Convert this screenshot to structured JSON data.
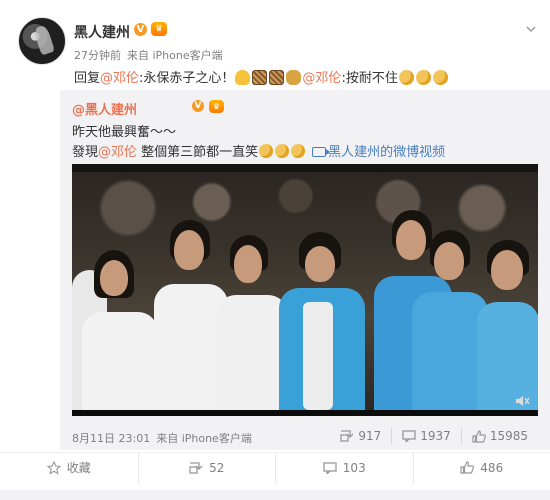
{
  "post": {
    "author": "黑人建州",
    "badge_icon": "verified-v-icon",
    "vip_icon": "vip-crown-icon",
    "time": "27分钟前",
    "source": "来自 iPhone客户端",
    "reply_prefix": "回复",
    "reply_mention": "@邓伦",
    "reply_text": ":永保赤子之心！",
    "reply_mention2": "@邓伦",
    "reply_text2": ":按耐不住"
  },
  "retweet": {
    "author": "@黑人建州",
    "line1": "昨天他最興奮～～",
    "line2_prefix": "發現",
    "line2_mention": "@邓伦",
    "line2_text": " 整個第三節都一直笑",
    "video_link": "黑人建州的微博视频",
    "date": "8月11日 23:01",
    "source": "来自 iPhone客户端",
    "stats": {
      "reposts": "917",
      "comments": "1937",
      "likes": "15985"
    }
  },
  "actions": {
    "favorite": "收藏",
    "repost": "52",
    "comment": "103",
    "like": "486"
  },
  "colors": {
    "mention": "#eb7350",
    "link": "#4a7ebb",
    "muted": "#808080",
    "retweet_bg": "#f2f2f5"
  }
}
